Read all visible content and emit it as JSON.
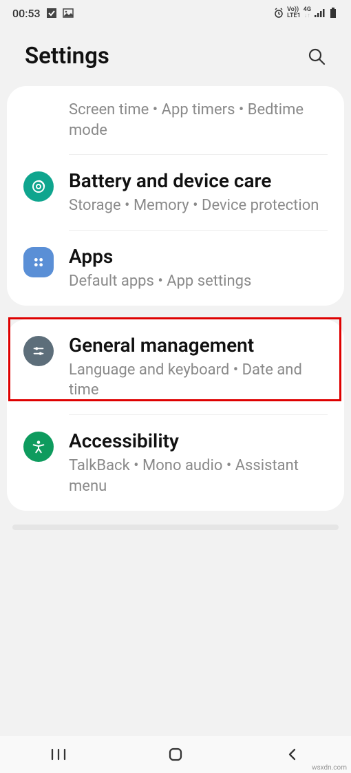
{
  "status": {
    "time": "00:53",
    "net_label_top": "Vo))",
    "net_label_bot": "LTE1",
    "net_speed": "4G"
  },
  "header": {
    "title": "Settings"
  },
  "groups": [
    {
      "items": [
        {
          "title": "",
          "subtitle": "Screen time  •  App timers  •  Bedtime mode",
          "icon": null
        },
        {
          "title": "Battery and device care",
          "subtitle": "Storage  •  Memory  •  Device protection",
          "icon": "device-care",
          "icon_color": "#0fa58e"
        },
        {
          "title": "Apps",
          "subtitle": "Default apps  •  App settings",
          "icon": "apps",
          "icon_color": "#5a8fd6",
          "highlighted": true
        }
      ]
    },
    {
      "items": [
        {
          "title": "General management",
          "subtitle": "Language and keyboard  •  Date and time",
          "icon": "general",
          "icon_color": "#5d6e7a"
        },
        {
          "title": "Accessibility",
          "subtitle": "TalkBack  •  Mono audio  •  Assistant menu",
          "icon": "accessibility",
          "icon_color": "#0e9b5e"
        }
      ]
    }
  ],
  "footer": "wsxdn.com"
}
